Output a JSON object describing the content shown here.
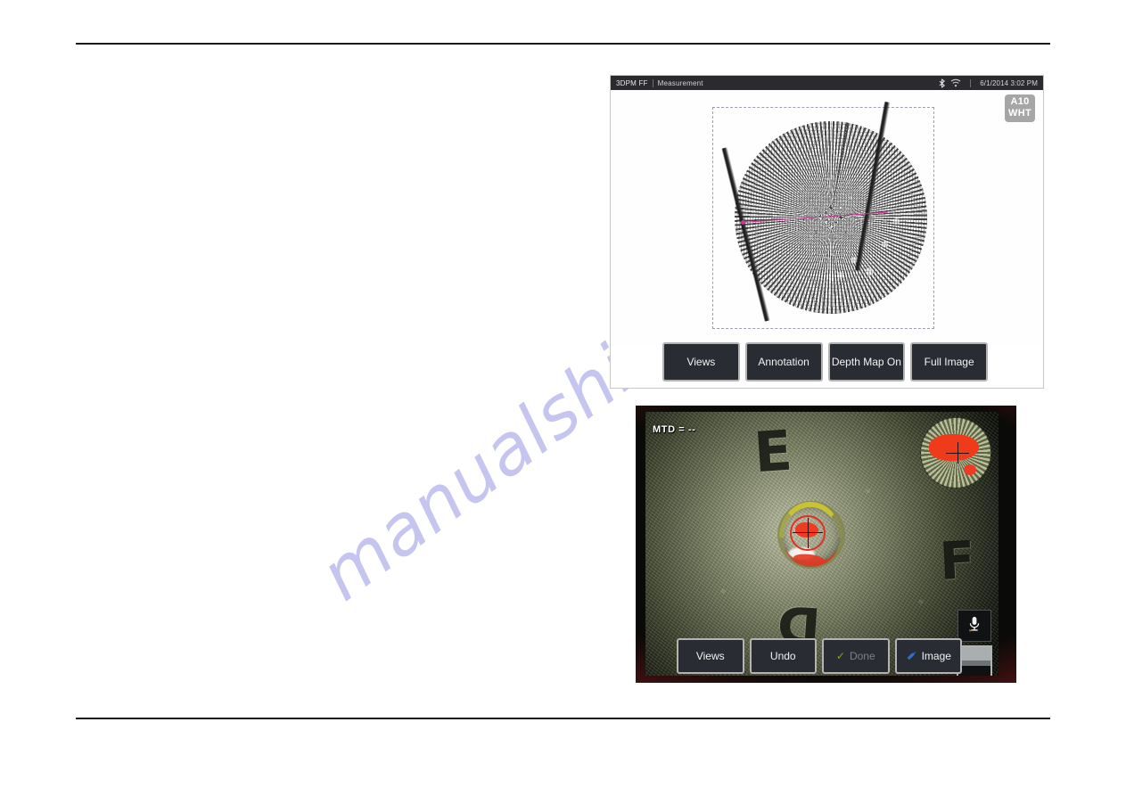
{
  "page": {
    "watermark": "manualshive.com"
  },
  "depthmap_screen": {
    "titlebar": {
      "app": "3DPM FF",
      "separator": "|",
      "mode": "Measurement",
      "bluetooth_icon": "bluetooth-icon",
      "wifi_icon": "wifi-icon",
      "datetime": "6/1/2014 3:02 PM"
    },
    "probe_badge": {
      "line1": "A10",
      "line2": "WHT"
    },
    "softkeys": [
      {
        "label": "Views",
        "name": "views-button",
        "disabled": false
      },
      {
        "label": "Annotation",
        "name": "annotation-button",
        "disabled": false
      },
      {
        "label": "Depth Map On",
        "name": "depth-map-on-button",
        "disabled": false
      },
      {
        "label": "Full Image",
        "name": "full-image-button",
        "disabled": false
      }
    ],
    "colors": {
      "titlebar_bg": "#2b2b2f",
      "softkey_bg": "#2a2c33",
      "softkey_border": "#b3b3b3",
      "measure_line": "#d62f96",
      "badge_bg": "#a6a6a6"
    }
  },
  "live_screen": {
    "mtd_readout": "MTD = --",
    "etched_letters": {
      "top": "E",
      "right": "F",
      "bottom": "D"
    },
    "softkeys": [
      {
        "label": "Views",
        "name": "views-button",
        "disabled": false,
        "icon": ""
      },
      {
        "label": "Undo",
        "name": "undo-button",
        "disabled": false,
        "icon": ""
      },
      {
        "label": "Done",
        "name": "done-button",
        "disabled": true,
        "icon": "check-icon"
      },
      {
        "label": "Image",
        "name": "image-button",
        "disabled": false,
        "icon": "tag-icon"
      }
    ],
    "mic_icon": "microphone-icon",
    "thumbnail": "thumbnail-preview",
    "colors": {
      "frame_red": "#c21f1f",
      "measure_red": "#e03024",
      "crater_yellow": "#c8c234",
      "tag_blue": "#2f6fd0",
      "check_green": "#8f9b2c"
    }
  }
}
